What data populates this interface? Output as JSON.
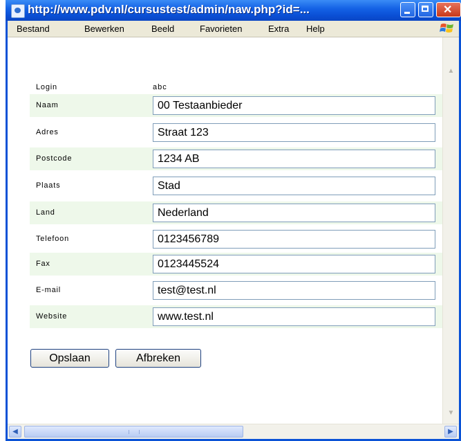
{
  "window": {
    "title": "http://www.pdv.nl/cursustest/admin/naw.php?id=..."
  },
  "menu": [
    "Bestand",
    "Bewerken",
    "Beeld",
    "Favorieten",
    "Extra",
    "Help"
  ],
  "form": {
    "login_label": "Login",
    "login_value": "abc",
    "fields": [
      {
        "label": "Naam",
        "value": "00 Testaanbieder"
      },
      {
        "label": "Adres",
        "value": "Straat 123"
      },
      {
        "label": "Postcode",
        "value": "1234 AB"
      },
      {
        "label": "Plaats",
        "value": "Stad"
      },
      {
        "label": "Land",
        "value": "Nederland"
      },
      {
        "label": "Telefoon",
        "value": "0123456789"
      },
      {
        "label": "Fax",
        "value": "0123445524"
      },
      {
        "label": "E-mail",
        "value": "test@test.nl"
      },
      {
        "label": "Website",
        "value": "www.test.nl"
      }
    ]
  },
  "buttons": {
    "save": "Opslaan",
    "cancel": "Afbreken"
  },
  "icons": {
    "window": "ie-page-icon",
    "menubar": "windows-logo-icon"
  },
  "colors": {
    "titlebar": "#0a52d6",
    "row_alt": "#eef8ea",
    "field_border": "#7f9db9"
  }
}
